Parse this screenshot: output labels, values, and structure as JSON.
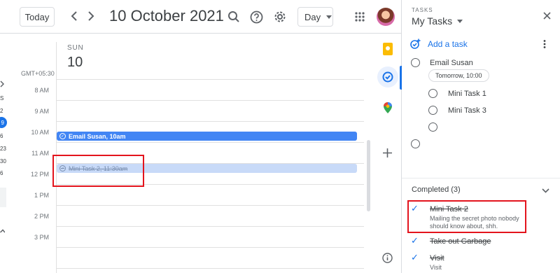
{
  "header": {
    "today_label": "Today",
    "prev_icon": "chevron-left-icon",
    "next_icon": "chevron-right-icon",
    "date_title": "10 October 2021",
    "search_icon": "search-icon",
    "help_icon": "help-icon",
    "settings_icon": "gear-icon",
    "view_label": "Day",
    "apps_icon": "apps-grid-icon"
  },
  "mini_calendar": {
    "partial_labels": [
      "S",
      "2",
      "6",
      "23",
      "30",
      "6"
    ],
    "selected": "9"
  },
  "day": {
    "weekday": "SUN",
    "number": "10",
    "timezone": "GMT+05:30"
  },
  "hours": [
    "8 AM",
    "9 AM",
    "10 AM",
    "11 AM",
    "12 PM",
    "1 PM",
    "2 PM",
    "3 PM"
  ],
  "events": [
    {
      "title": "Email Susan, 10am",
      "status": "active"
    },
    {
      "title": "Mini Task 2, 11:30am",
      "status": "completed"
    }
  ],
  "rail": {
    "keep_icon": "keep-icon",
    "tasks_icon": "tasks-icon",
    "maps_icon": "maps-icon",
    "add_icon": "plus-icon",
    "info_icon": "info-icon"
  },
  "tasks_panel": {
    "kicker": "TASKS",
    "list_name": "My Tasks",
    "add_task_label": "Add a task",
    "tasks": [
      {
        "title": "Email Susan",
        "due": "Tomorrow, 10:00"
      },
      {
        "title": "Mini Task 1",
        "subtask": true
      },
      {
        "title": "Mini Task 3",
        "subtask": true
      },
      {
        "title": "",
        "subtask": true
      },
      {
        "title": ""
      }
    ],
    "completed_label": "Completed (3)",
    "completed": [
      {
        "title": "Mini Task 2",
        "note": "Mailing the secret photo nobody should know about, shh."
      },
      {
        "title": "Take out Garbage",
        "note": ""
      },
      {
        "title": "Visit",
        "note": "Visit"
      }
    ]
  },
  "colors": {
    "accent": "#1a73e8",
    "event_blue": "#4285f4",
    "event_completed": "#c8daf8",
    "highlight_red": "#e3141d"
  }
}
